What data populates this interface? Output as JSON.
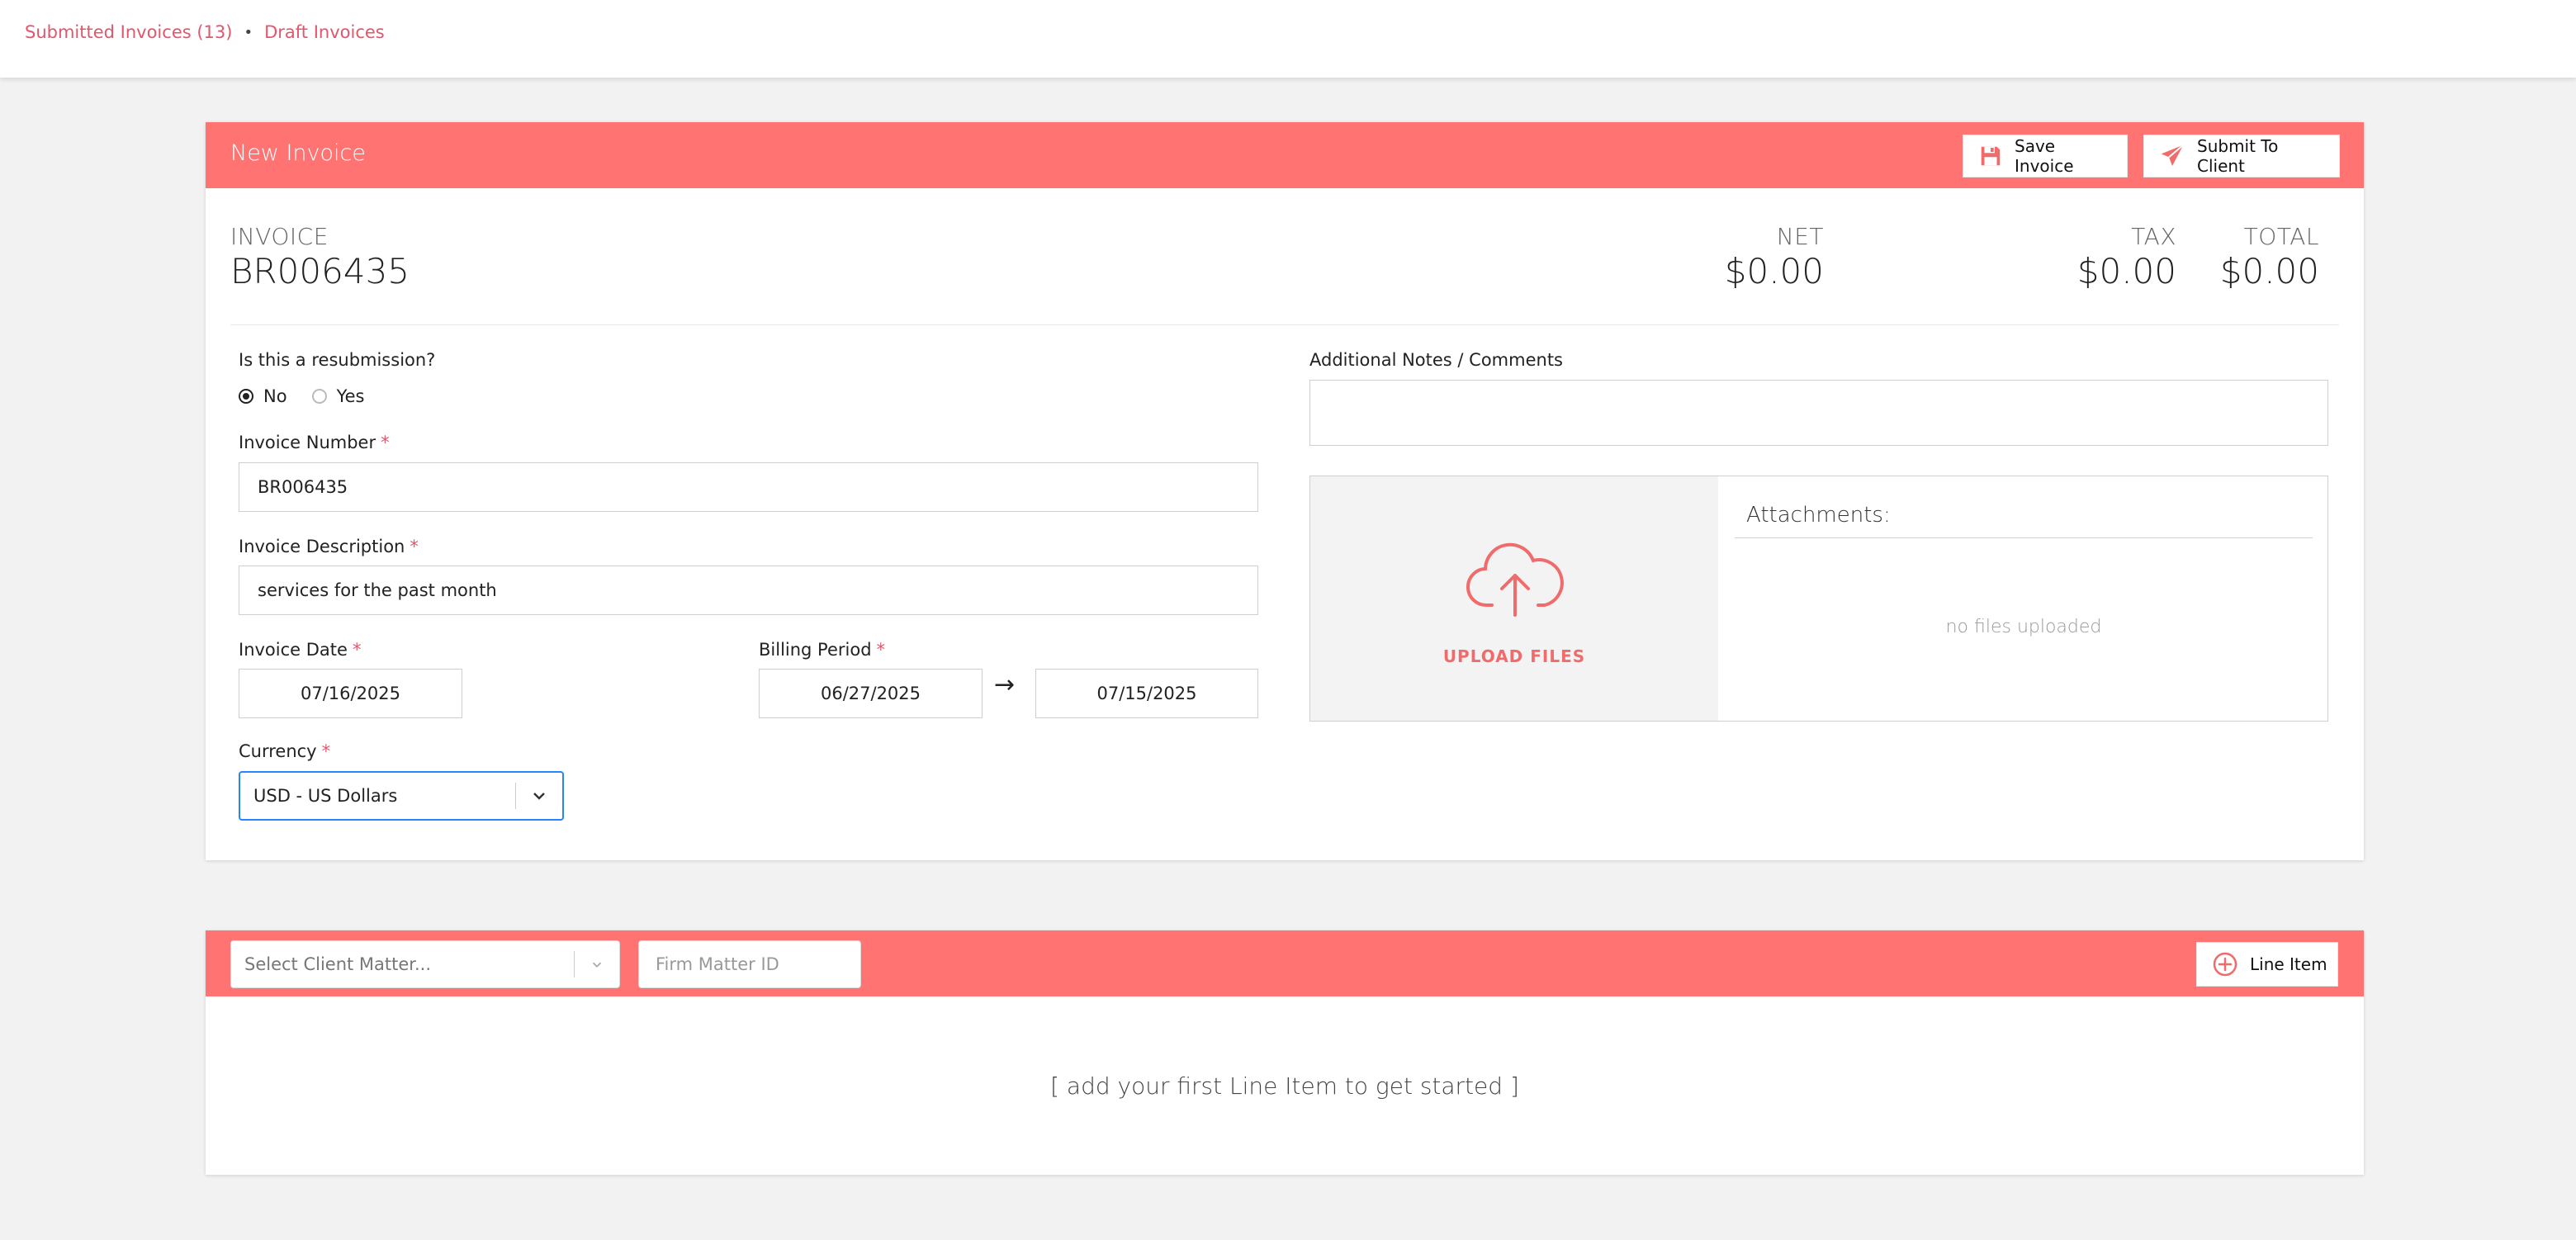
{
  "breadcrumb": {
    "submitted": "Submitted Invoices (13)",
    "separator": "•",
    "draft": "Draft Invoices"
  },
  "invoice_card": {
    "title": "New Invoice",
    "save_label": "Save Invoice",
    "submit_label": "Submit To Client",
    "summary": {
      "invoice_label": "INVOICE",
      "invoice_value": "BR006435",
      "net_label": "NET",
      "net_value": "$0.00",
      "tax_label": "TAX",
      "tax_value": "$0.00",
      "total_label": "TOTAL",
      "total_value": "$0.00"
    },
    "form": {
      "resubmission_label": "Is this a resubmission?",
      "resubmission_options": [
        "No",
        "Yes"
      ],
      "resubmission_selected": "No",
      "invoice_number_label": "Invoice Number",
      "invoice_number_value": "BR006435",
      "description_label": "Invoice Description",
      "description_value": "services for the past month",
      "invoice_date_label": "Invoice Date",
      "invoice_date_value": "07/16/2025",
      "billing_period_label": "Billing Period",
      "billing_start": "06/27/2025",
      "billing_arrow": "→",
      "billing_end": "07/15/2025",
      "currency_label": "Currency",
      "currency_value": "USD - US Dollars",
      "required_marker": "*"
    },
    "notes_label": "Additional Notes / Comments",
    "notes_value": "",
    "upload_label": "UPLOAD FILES",
    "attachments_title": "Attachments:",
    "attachments_empty": "no files uploaded"
  },
  "line_items_card": {
    "client_matter_placeholder": "Select Client Matter...",
    "firm_matter_placeholder": "Firm Matter ID",
    "line_item_label": "Line Item",
    "empty_message": "[ add your first Line Item to get started ]"
  },
  "colors": {
    "accent": "#ff7373",
    "link": "#e0576b",
    "focus": "#2684ff"
  },
  "icons": {
    "save": "floppy-disk-icon",
    "submit": "paper-plane-icon",
    "upload": "cloud-upload-icon",
    "add": "plus-circle-icon",
    "chevron": "chevron-down-icon"
  }
}
